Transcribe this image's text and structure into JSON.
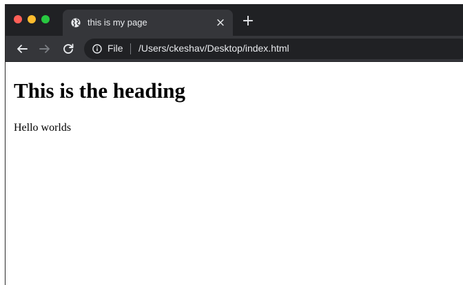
{
  "browser": {
    "tab": {
      "title": "this is my page",
      "close_glyph": "×",
      "favicon": "globe-icon"
    },
    "new_tab_glyph": "+",
    "toolbar": {
      "back_icon": "arrow-left-icon",
      "forward_icon": "arrow-right-icon",
      "reload_icon": "reload-icon",
      "omnibox": {
        "info_icon": "info-icon",
        "origin_label": "File",
        "url": "/Users/ckeshav/Desktop/index.html"
      }
    },
    "colors": {
      "titlebar": "#202124",
      "toolbar": "#35363a",
      "omnibox": "#202124",
      "text": "#e8eaed",
      "traffic_red": "#ff5f57",
      "traffic_yellow": "#febc2e",
      "traffic_green": "#28c840"
    }
  },
  "page": {
    "heading": "This is the heading",
    "paragraph": "Hello worlds"
  }
}
